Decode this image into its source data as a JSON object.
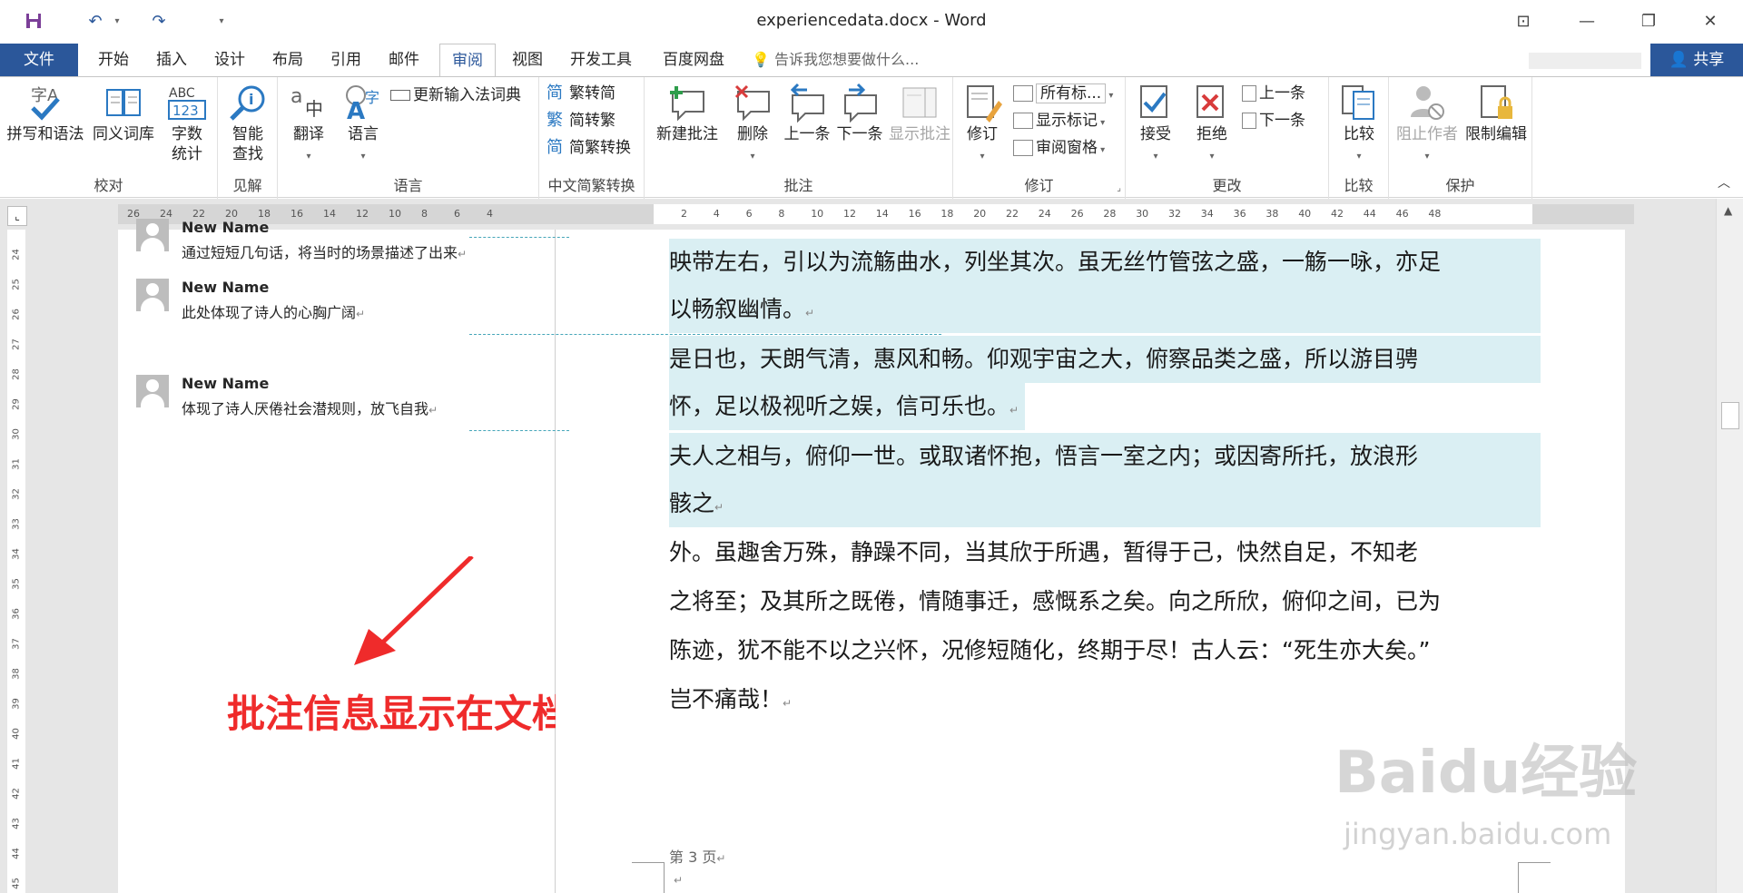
{
  "titlebar": {
    "title": "experiencedata.docx - Word",
    "save_icon": "save-icon",
    "undo_icon": "undo-icon",
    "redo_icon": "redo-icon",
    "customize_icon": "customize-quick-access-icon"
  },
  "tabs": {
    "file": "文件",
    "items": [
      "开始",
      "插入",
      "设计",
      "布局",
      "引用",
      "邮件",
      "审阅",
      "视图",
      "开发工具",
      "百度网盘"
    ],
    "active": "审阅",
    "tell_me": "告诉我您想要做什么...",
    "share": "共享"
  },
  "ribbon": {
    "groups": {
      "proofing": "校对",
      "insights": "见解",
      "language": "语言",
      "chinese_conversion": "中文简繁转换",
      "comments": "批注",
      "tracking": "修订",
      "changes": "更改",
      "compare": "比较",
      "protect": "保护"
    },
    "buttons": {
      "spelling": "拼写和语法",
      "thesaurus": "同义词库",
      "word_count_1": "字数",
      "word_count_2": "统计",
      "smart_lookup_1": "智能",
      "smart_lookup_2": "查找",
      "translate": "翻译",
      "language": "语言",
      "update_ime": "更新输入法词典",
      "to_simplified": "繁转简",
      "to_traditional": "简转繁",
      "convert": "简繁转换",
      "new_comment": "新建批注",
      "delete": "删除",
      "previous": "上一条",
      "next": "下一条",
      "show_comments": "显示批注",
      "track_changes": "修订",
      "all_markup": "所有标...",
      "show_markup": "显示标记",
      "reviewing_pane": "审阅窗格",
      "accept": "接受",
      "reject": "拒绝",
      "change_prev": "上一条",
      "change_next": "下一条",
      "compare": "比较",
      "block_authors": "阻止作者",
      "restrict_editing": "限制编辑"
    }
  },
  "ruler": {
    "left_ticks": [
      "26",
      "24",
      "22",
      "20",
      "18",
      "16",
      "14",
      "12",
      "10",
      "8",
      "6",
      "4"
    ],
    "right_ticks": [
      "2",
      "4",
      "6",
      "8",
      "10",
      "12",
      "14",
      "16",
      "18",
      "20",
      "22",
      "24",
      "26",
      "28",
      "30",
      "32",
      "34",
      "36",
      "38",
      "40",
      "42",
      "44",
      "46",
      "48"
    ],
    "vertical_ticks": [
      "24",
      "25",
      "26",
      "27",
      "28",
      "29",
      "30",
      "31",
      "32",
      "33",
      "34",
      "35",
      "36",
      "37",
      "38",
      "39",
      "40",
      "41",
      "42",
      "43",
      "44",
      "45"
    ]
  },
  "comments": [
    {
      "author": "New Name",
      "text": "通过短短几句话，将当时的场景描述了出来"
    },
    {
      "author": "New Name",
      "text": "此处体现了诗人的心胸广阔"
    },
    {
      "author": "New Name",
      "text": "体现了诗人厌倦社会潜规则，放飞自我"
    }
  ],
  "annotation": "批注信息显示在文档左侧",
  "document": {
    "lines": [
      "映带左右，引以为流觞曲水，列坐其次。虽无丝竹管弦之盛，一觞一咏，亦足",
      "以畅叙幽情。",
      " 是日也，天朗气清，惠风和畅。仰观宇宙之大，俯察品类之盛，所以游目骋",
      "怀，足以极视听之娱，信可乐也。",
      " 夫人之相与，俯仰一世。或取诸怀抱，悟言一室之内；或因寄所托，放浪形",
      "骸之",
      " 外。虽趣舍万殊，静躁不同，当其欣于所遇，暂得于己，快然自足，不知老",
      "之将至；及其所之既倦，情随事迁，感慨系之矣。向之所欣，俯仰之间，已为",
      "陈迹，犹不能不以之兴怀，况修短随化，终期于尽！古人云：“死生亦大矣。”",
      "岂不痛哉！"
    ],
    "page_footer": "第 3 页",
    "pilcrow": "↵"
  },
  "watermark": {
    "main": "Baidu经验",
    "sub": "jingyan.baidu.com"
  },
  "colors": {
    "accent": "#2b579a",
    "highlight": "#daeff3",
    "comment_bar": "#46a6b9",
    "annotation": "#ef2b2b"
  }
}
